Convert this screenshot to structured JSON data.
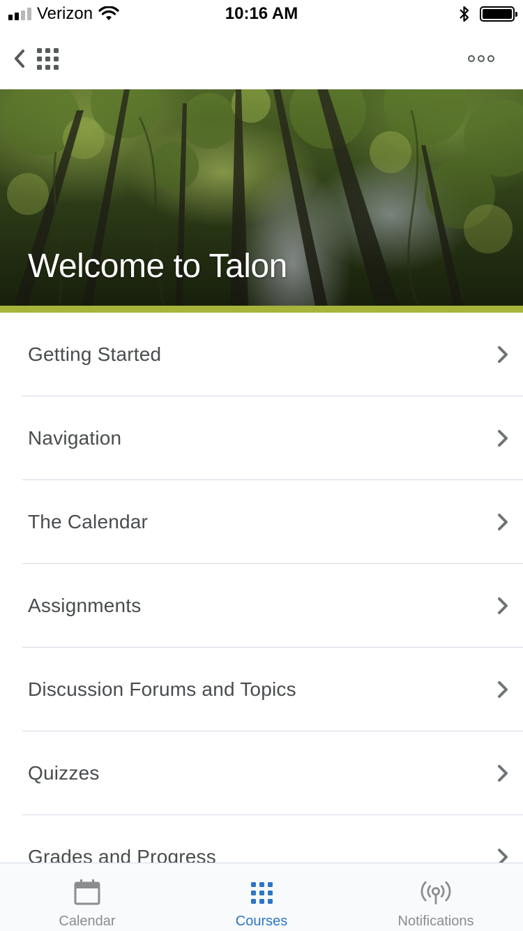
{
  "status_bar": {
    "carrier": "Verizon",
    "time": "10:16 AM",
    "signal_bars_filled": 2,
    "signal_bars_total": 4,
    "battery_level": 1.0
  },
  "nav": {
    "back_icon": "chevron-left-icon",
    "apps_icon": "grid-icon",
    "more_icon": "more-dots-icon"
  },
  "banner": {
    "title": "Welcome to Talon"
  },
  "topics": [
    {
      "label": "Getting Started"
    },
    {
      "label": "Navigation"
    },
    {
      "label": "The Calendar"
    },
    {
      "label": "Assignments"
    },
    {
      "label": "Discussion Forums and Topics"
    },
    {
      "label": "Quizzes"
    },
    {
      "label": "Grades and Progress"
    }
  ],
  "tabs": [
    {
      "label": "Calendar",
      "icon": "calendar-icon",
      "active": false
    },
    {
      "label": "Courses",
      "icon": "grid-icon",
      "active": true
    },
    {
      "label": "Notifications",
      "icon": "broadcast-icon",
      "active": false
    }
  ],
  "colors": {
    "accent_stripe": "#a7b43a",
    "active_tab": "#2b76c6",
    "inactive_tab": "#8a8c8e",
    "text": "#494c4e",
    "chevron": "#6e7376",
    "divider": "#d3d9e3"
  }
}
